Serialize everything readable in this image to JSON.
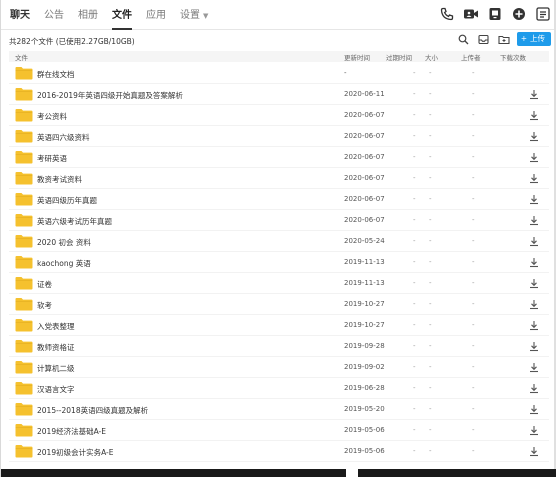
{
  "tabs": [
    {
      "label": "聊天"
    },
    {
      "label": "公告"
    },
    {
      "label": "相册"
    },
    {
      "label": "文件"
    },
    {
      "label": "应用"
    },
    {
      "label": "设置"
    }
  ],
  "toolbar": {
    "file_count": "共282个文件 (已使用2.27GB/10GB)",
    "upload_label": "上传"
  },
  "columns": {
    "file": "文件",
    "updated": "更新时间",
    "expire": "过期时间",
    "size": "大小",
    "uploader": "上传者",
    "downloads": "下载次数"
  },
  "rows": [
    {
      "name": "群在线文档",
      "date": "-",
      "expire": "-",
      "size": "-",
      "uploader": "-",
      "download": false
    },
    {
      "name": "2016-2019年英语四级开始真题及答案解析",
      "date": "2020-06-11",
      "expire": "-",
      "size": "-",
      "uploader": "-",
      "download": true
    },
    {
      "name": "考公资料",
      "date": "2020-06-07",
      "expire": "-",
      "size": "-",
      "uploader": "-",
      "download": true
    },
    {
      "name": "英语四六级资料",
      "date": "2020-06-07",
      "expire": "-",
      "size": "-",
      "uploader": "-",
      "download": true
    },
    {
      "name": "考研英语",
      "date": "2020-06-07",
      "expire": "-",
      "size": "-",
      "uploader": "-",
      "download": true
    },
    {
      "name": "教资考试资料",
      "date": "2020-06-07",
      "expire": "-",
      "size": "-",
      "uploader": "-",
      "download": true
    },
    {
      "name": "英语四级历年真题",
      "date": "2020-06-07",
      "expire": "-",
      "size": "-",
      "uploader": "-",
      "download": true
    },
    {
      "name": "英语六级考试历年真题",
      "date": "2020-06-07",
      "expire": "-",
      "size": "-",
      "uploader": "-",
      "download": true
    },
    {
      "name": "2020 初会 资料",
      "date": "2020-05-24",
      "expire": "-",
      "size": "-",
      "uploader": "-",
      "download": true
    },
    {
      "name": "kaochong 英语",
      "date": "2019-11-13",
      "expire": "-",
      "size": "-",
      "uploader": "-",
      "download": true
    },
    {
      "name": "证卷",
      "date": "2019-11-13",
      "expire": "-",
      "size": "-",
      "uploader": "-",
      "download": true
    },
    {
      "name": "软考",
      "date": "2019-10-27",
      "expire": "-",
      "size": "-",
      "uploader": "-",
      "download": true
    },
    {
      "name": "入党表整理",
      "date": "2019-10-27",
      "expire": "-",
      "size": "-",
      "uploader": "-",
      "download": true
    },
    {
      "name": "教师资格证",
      "date": "2019-09-28",
      "expire": "-",
      "size": "-",
      "uploader": "-",
      "download": true
    },
    {
      "name": "计算机二级",
      "date": "2019-09-02",
      "expire": "-",
      "size": "-",
      "uploader": "-",
      "download": true
    },
    {
      "name": "汉语言文字",
      "date": "2019-06-28",
      "expire": "-",
      "size": "-",
      "uploader": "-",
      "download": true
    },
    {
      "name": "2015--2018英语四级真题及解析",
      "date": "2019-05-20",
      "expire": "-",
      "size": "-",
      "uploader": "-",
      "download": true
    },
    {
      "name": "2019经济法基础A-E",
      "date": "2019-05-06",
      "expire": "-",
      "size": "-",
      "uploader": "-",
      "download": true
    },
    {
      "name": "2019初级会计实务A-E",
      "date": "2019-05-06",
      "expire": "-",
      "size": "-",
      "uploader": "-",
      "download": true
    }
  ],
  "colors": {
    "folder": "#f5c12e",
    "accent": "#1e9bea"
  }
}
